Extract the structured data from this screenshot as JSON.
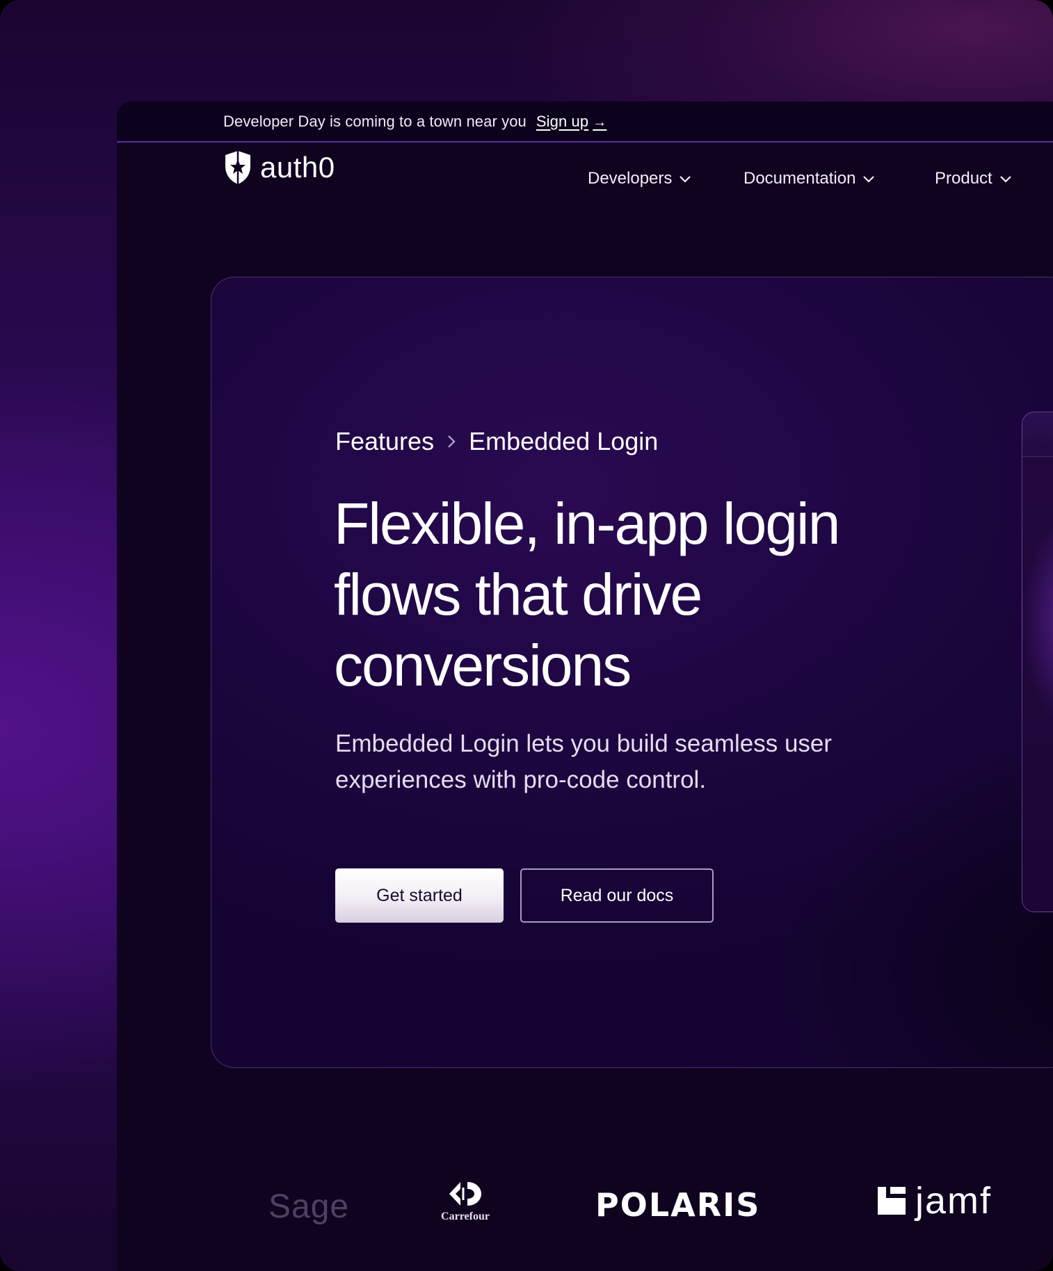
{
  "banner": {
    "message": "Developer Day is coming to a town near you",
    "link_label": "Sign up",
    "link_arrow": "→"
  },
  "brand": {
    "name": "auth0",
    "icon": "auth0-shield-icon"
  },
  "nav": {
    "items": [
      {
        "label": "Developers",
        "icon": "chevron-down-icon"
      },
      {
        "label": "Documentation",
        "icon": "chevron-down-icon"
      },
      {
        "label": "Product",
        "icon": "chevron-down-icon"
      }
    ]
  },
  "breadcrumb": {
    "items": [
      "Features",
      "Embedded Login"
    ],
    "separator_icon": "chevron-right-icon"
  },
  "hero": {
    "headline_lines": [
      "Flexible, in-app login",
      "flows that drive",
      "conversions"
    ],
    "subtext": "Embedded Login lets you build seamless user experiences with pro-code control.",
    "primary_button": "Get started",
    "secondary_button": "Read our docs"
  },
  "customer_logos": {
    "items": [
      "Sage",
      "Carrefour",
      "POLARIS",
      "jamf"
    ]
  },
  "colors": {
    "background_dark": "#0f0320",
    "accent_purple": "#5e2ca8",
    "text_white": "#ffffff"
  }
}
